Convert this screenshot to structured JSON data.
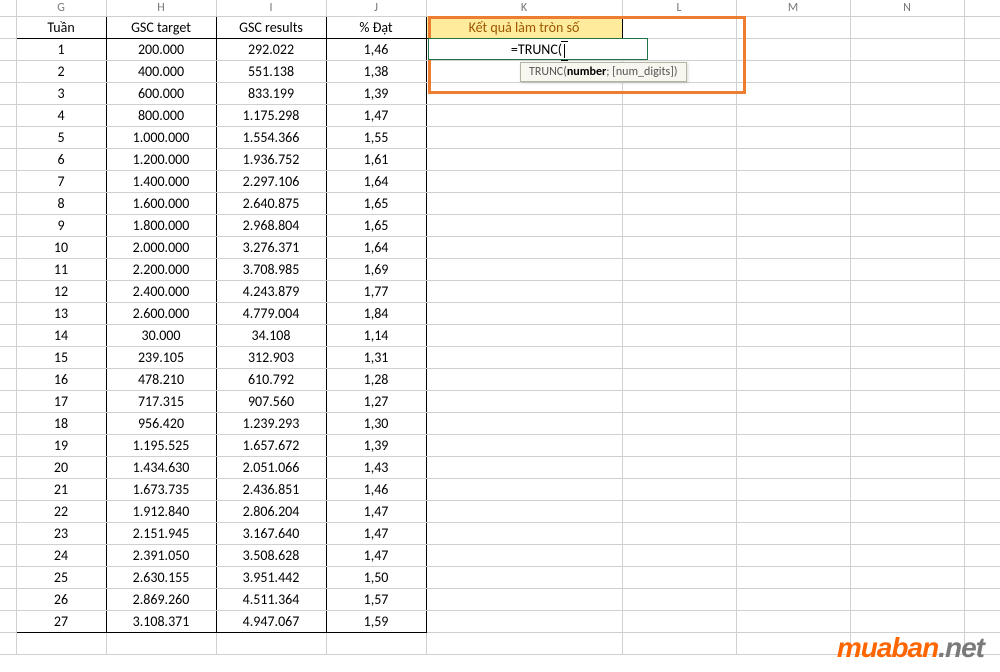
{
  "col_letters": [
    "",
    "G",
    "H",
    "I",
    "J",
    "K",
    "L",
    "M",
    "N",
    ""
  ],
  "headers": {
    "tuan": "Tuần",
    "gsc_target": "GSC target",
    "gsc_results": "GSC results",
    "pct_dat": "% Đạt",
    "ket_qua": "Kết quả làm tròn số"
  },
  "rows": [
    {
      "tuan": "1",
      "target": "200.000",
      "results": "292.022",
      "pct": "1,46"
    },
    {
      "tuan": "2",
      "target": "400.000",
      "results": "551.138",
      "pct": "1,38"
    },
    {
      "tuan": "3",
      "target": "600.000",
      "results": "833.199",
      "pct": "1,39"
    },
    {
      "tuan": "4",
      "target": "800.000",
      "results": "1.175.298",
      "pct": "1,47"
    },
    {
      "tuan": "5",
      "target": "1.000.000",
      "results": "1.554.366",
      "pct": "1,55"
    },
    {
      "tuan": "6",
      "target": "1.200.000",
      "results": "1.936.752",
      "pct": "1,61"
    },
    {
      "tuan": "7",
      "target": "1.400.000",
      "results": "2.297.106",
      "pct": "1,64"
    },
    {
      "tuan": "8",
      "target": "1.600.000",
      "results": "2.640.875",
      "pct": "1,65"
    },
    {
      "tuan": "9",
      "target": "1.800.000",
      "results": "2.968.804",
      "pct": "1,65"
    },
    {
      "tuan": "10",
      "target": "2.000.000",
      "results": "3.276.371",
      "pct": "1,64"
    },
    {
      "tuan": "11",
      "target": "2.200.000",
      "results": "3.708.985",
      "pct": "1,69"
    },
    {
      "tuan": "12",
      "target": "2.400.000",
      "results": "4.243.879",
      "pct": "1,77"
    },
    {
      "tuan": "13",
      "target": "2.600.000",
      "results": "4.779.004",
      "pct": "1,84"
    },
    {
      "tuan": "14",
      "target": "30.000",
      "results": "34.108",
      "pct": "1,14"
    },
    {
      "tuan": "15",
      "target": "239.105",
      "results": "312.903",
      "pct": "1,31"
    },
    {
      "tuan": "16",
      "target": "478.210",
      "results": "610.792",
      "pct": "1,28"
    },
    {
      "tuan": "17",
      "target": "717.315",
      "results": "907.560",
      "pct": "1,27"
    },
    {
      "tuan": "18",
      "target": "956.420",
      "results": "1.239.293",
      "pct": "1,30"
    },
    {
      "tuan": "19",
      "target": "1.195.525",
      "results": "1.657.672",
      "pct": "1,39"
    },
    {
      "tuan": "20",
      "target": "1.434.630",
      "results": "2.051.066",
      "pct": "1,43"
    },
    {
      "tuan": "21",
      "target": "1.673.735",
      "results": "2.436.851",
      "pct": "1,46"
    },
    {
      "tuan": "22",
      "target": "1.912.840",
      "results": "2.806.204",
      "pct": "1,47"
    },
    {
      "tuan": "23",
      "target": "2.151.945",
      "results": "3.167.640",
      "pct": "1,47"
    },
    {
      "tuan": "24",
      "target": "2.391.050",
      "results": "3.508.628",
      "pct": "1,47"
    },
    {
      "tuan": "25",
      "target": "2.630.155",
      "results": "3.951.442",
      "pct": "1,50"
    },
    {
      "tuan": "26",
      "target": "2.869.260",
      "results": "4.511.364",
      "pct": "1,57"
    },
    {
      "tuan": "27",
      "target": "3.108.371",
      "results": "4.947.067",
      "pct": "1,59"
    }
  ],
  "formula": {
    "text": "=TRUNC(",
    "tooltip_prefix": "TRUNC(",
    "tooltip_bold": "number",
    "tooltip_suffix": "; [num_digits])"
  },
  "watermark": {
    "brand": "muaban",
    "tld": ".net"
  }
}
